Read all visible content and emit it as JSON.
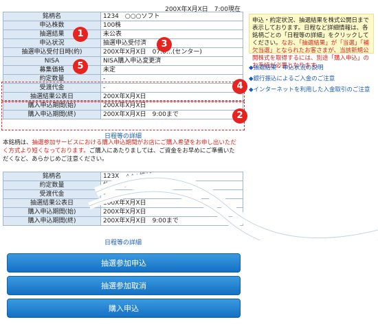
{
  "timestamp": "200X年X月X日　7:00現在",
  "table1": {
    "rows": [
      {
        "label": "銘柄名",
        "value": "1234　○○○ソフト"
      },
      {
        "label": "申込株数",
        "value": "100株"
      },
      {
        "label": "抽選結果",
        "value": "未公表"
      },
      {
        "label": "申込状況",
        "value": "抽選申込受付済"
      },
      {
        "label": "抽選申込受付日時(約)",
        "value": "200X年X月X日　07:0…(センター)"
      },
      {
        "label": "NISA",
        "value": "NISA購入申込変更済"
      },
      {
        "label": "募集価格",
        "value": "未定"
      },
      {
        "label": "約定数量",
        "value": "-"
      },
      {
        "label": "受渡代金",
        "value": "-"
      },
      {
        "label": "抽選結果公表日",
        "value": "200X年X月X日"
      },
      {
        "label": "購入申込期間(始)",
        "value": "200X年X月X日"
      },
      {
        "label": "購入申込期間(終)",
        "value": "200X年X月X日　9:00まで"
      }
    ],
    "detail_link": "日程等の詳細"
  },
  "notice": {
    "prefix": "本銘柄は、",
    "red": "抽選参加サービスにおける購入申込期間がお店にご購入希望をお申し出いただく方式より短くなっております。",
    "suffix": "ご購入にあたりましては、ご資金をお早めにご準備いただくなど、あらかじめご注意ください。"
  },
  "table2": {
    "rows": [
      {
        "label": "銘柄名",
        "value": "123X　△△△機械"
      },
      {
        "label": "約定数量",
        "value": "約定なし"
      },
      {
        "label": "受渡代金",
        "value": "-"
      },
      {
        "label": "抽選結果公表日",
        "value": "200X年X月X日"
      },
      {
        "label": "購入申込期間(始)",
        "value": "200X年X月X日"
      },
      {
        "label": "購入申込期間(終)",
        "value": "200X年X月X日　9:00まで"
      }
    ],
    "detail_link": "日程等の詳細"
  },
  "sidebar": {
    "box_text_1": "申込・約定状況、抽選結果を株式公開日まで表示しております。",
    "box_text_2": "日程など詳細情報は、各銘柄ごとの「日程等の詳細」をクリックしてください。",
    "box_red": "なお、「抽選結果」が「当選」「補欠当選」となられたお客さまが、当該新規公開株式を取得するには、別途「購入申込」のお手続が必要となります。",
    "links": [
      "◆抽選結果・申込状況の説明",
      "◆銀行振込によるご入金のご注意",
      "◆インターネットを利用した入金取引のご注意"
    ]
  },
  "callouts": [
    "1",
    "2",
    "3",
    "4",
    "5"
  ],
  "buttons": {
    "lottery_apply": "抽選参加申込",
    "lottery_cancel": "抽選参加取消",
    "purchase_apply": "購入申込"
  },
  "colors": {
    "accent_red": "#e52320",
    "link_blue": "#1a5bb8",
    "label_bg": "#dce8f4",
    "button_blue": "#1f7fd0"
  }
}
